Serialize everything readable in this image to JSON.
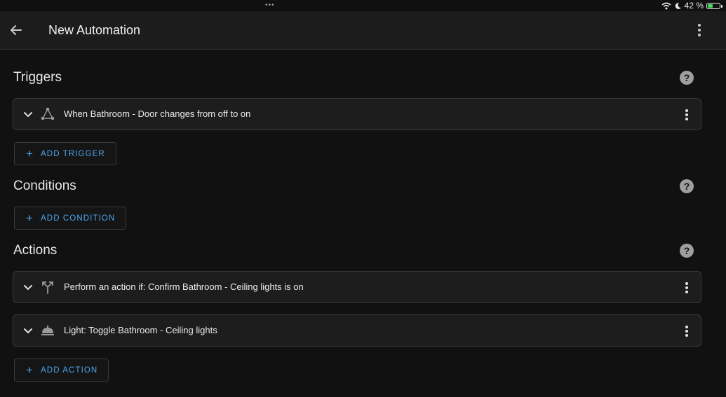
{
  "status_bar": {
    "dots": "•••",
    "battery_text": "42 %"
  },
  "appbar": {
    "title": "New Automation"
  },
  "triggers": {
    "title": "Triggers",
    "help": "?",
    "items": [
      {
        "label": "When Bathroom - Door changes from off to on",
        "icon": "state-trigger-icon"
      }
    ],
    "add_label": "ADD TRIGGER"
  },
  "conditions": {
    "title": "Conditions",
    "help": "?",
    "add_label": "ADD CONDITION"
  },
  "actions": {
    "title": "Actions",
    "help": "?",
    "items": [
      {
        "label": "Perform an action if: Confirm Bathroom - Ceiling lights is on",
        "icon": "choose-branch-icon"
      },
      {
        "label": "Light: Toggle Bathroom - Ceiling lights",
        "icon": "light-service-icon"
      }
    ],
    "add_label": "ADD ACTION"
  },
  "colors": {
    "accent": "#4ea6f0",
    "background": "#111111",
    "card": "#1d1d1d",
    "battery": "#4cd964"
  }
}
